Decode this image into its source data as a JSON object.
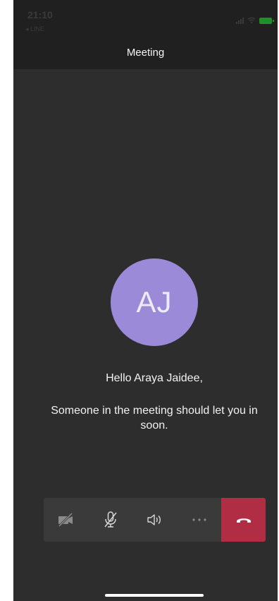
{
  "status_bar": {
    "time": "21:10",
    "back_label": "◂ LINE"
  },
  "header": {
    "title": "Meeting"
  },
  "participant": {
    "initials": "AJ",
    "avatar_color": "#9a8ad8"
  },
  "lobby": {
    "greeting": "Hello Araya Jaidee,",
    "message": "Someone in the meeting should let you in soon."
  },
  "call_controls": [
    {
      "icon": "video-off-icon"
    },
    {
      "icon": "mic-off-icon"
    },
    {
      "icon": "speaker-icon"
    },
    {
      "icon": "more-icon"
    },
    {
      "icon": "hang-up-icon",
      "color": "#b02d44"
    }
  ]
}
